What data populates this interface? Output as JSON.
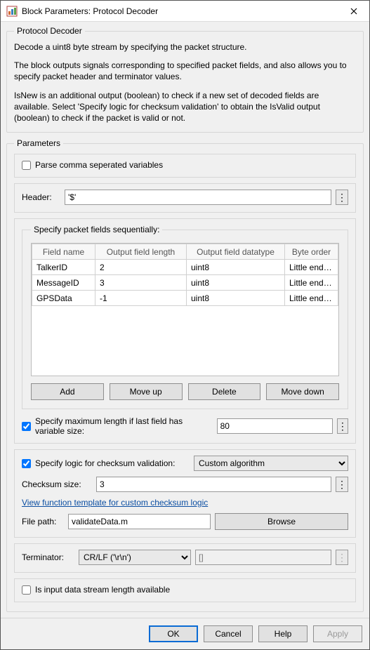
{
  "window": {
    "title": "Block Parameters: Protocol Decoder"
  },
  "top_group_title": "Protocol Decoder",
  "description": {
    "p1": "Decode a uint8 byte stream by specifying the packet structure.",
    "p2": "The block outputs signals corresponding to specified packet fields, and also allows you to specify packet header and terminator values.",
    "p3": "IsNew is an additional output (boolean) to check if a new set of decoded fields are available. Select 'Specify logic for checksum validation' to obtain the IsValid output (boolean) to check if the packet is valid or not."
  },
  "params_title": "Parameters",
  "csv_label": "Parse comma seperated variables",
  "csv_checked": false,
  "header": {
    "label": "Header:",
    "value": "'$'"
  },
  "fields_legend": "Specify packet fields sequentially:",
  "table": {
    "cols": [
      "Field name",
      "Output field length",
      "Output field datatype",
      "Byte order"
    ],
    "rows": [
      {
        "name": "TalkerID",
        "len": "2",
        "dtype": "uint8",
        "order": "Little endian"
      },
      {
        "name": "MessageID",
        "len": "3",
        "dtype": "uint8",
        "order": "Little endian"
      },
      {
        "name": "GPSData",
        "len": "-1",
        "dtype": "uint8",
        "order": "Little endian"
      }
    ]
  },
  "buttons": {
    "add": "Add",
    "up": "Move up",
    "del": "Delete",
    "down": "Move down"
  },
  "maxlen": {
    "label": "Specify maximum length if last field has variable size:",
    "checked": true,
    "value": "80"
  },
  "checksum": {
    "label": "Specify logic for checksum validation:",
    "checked": true,
    "algo": "Custom algorithm",
    "size_label": "Checksum size:",
    "size_value": "3",
    "link": "View function template for custom checksum logic",
    "file_label": "File path:",
    "file_value": "validateData.m",
    "browse": "Browse"
  },
  "terminator": {
    "label": "Terminator:",
    "select": "CR/LF ('\\r\\n')",
    "custom": "[]"
  },
  "stream_label": "Is input data stream length available",
  "stream_checked": false,
  "footer": {
    "ok": "OK",
    "cancel": "Cancel",
    "help": "Help",
    "apply": "Apply"
  }
}
